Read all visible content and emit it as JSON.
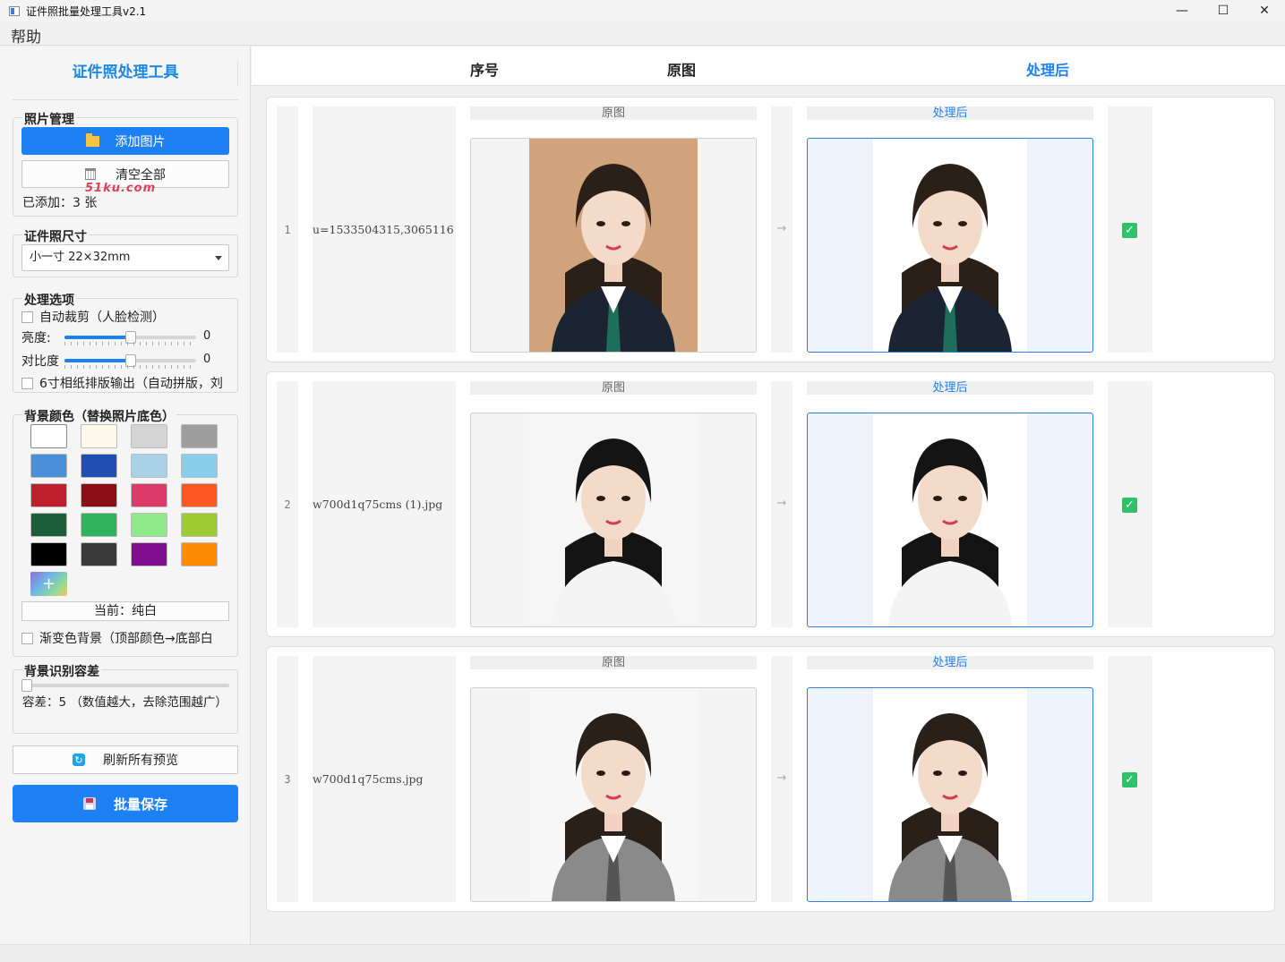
{
  "window": {
    "title": "证件照批量处理工具v2.1",
    "minimize": "—",
    "maximize": "☐",
    "close": "✕"
  },
  "menu": {
    "help": "帮助"
  },
  "sidebar": {
    "title": "证件照处理工具",
    "photo_mgmt": {
      "label": "照片管理",
      "add_button": "添加图片",
      "clear_button": "清空全部",
      "count_text": "已添加：3 张",
      "watermark": "51ku.com"
    },
    "size": {
      "label": "证件照尺寸",
      "selected": "小一寸  22×32mm"
    },
    "options": {
      "label": "处理选项",
      "auto_crop": "自动裁剪（人脸检测）",
      "brightness_label": "亮度:",
      "brightness_value": "0",
      "brightness_level": 0.5,
      "contrast_label": "对比度",
      "contrast_value": "0",
      "contrast_level": 0.5,
      "layout_6inch": "6寸相纸排版输出（自动拼版，刘"
    },
    "background": {
      "label": "背景颜色（替换照片底色）",
      "swatches": [
        "#ffffff",
        "#fdf8ea",
        "#d4d4d4",
        "#9e9e9e",
        "#4a90d9",
        "#1f4fb3",
        "#a9d1e6",
        "#87ceeb",
        "#c0202e",
        "#8b0f17",
        "#dd3b69",
        "#ff5722",
        "#1d5e3a",
        "#2fb35d",
        "#8fea8a",
        "#9ccc31",
        "#000000",
        "#3a3a3a",
        "#7f0f8f",
        "#ff8c00"
      ],
      "add_symbol": "+",
      "current_text": "当前：纯白",
      "gradient_option": "渐变色背景（顶部颜色→底部白"
    },
    "tolerance": {
      "label": "背景识别容差",
      "level": 0.0,
      "text": "容差：5  （数值越大，去除范围越广）"
    },
    "refresh_button": "刷新所有预览",
    "save_button": "批量保存"
  },
  "table": {
    "headers": {
      "index": "序号",
      "original": "原图",
      "processed": "处理后"
    },
    "rows": [
      {
        "index": "1",
        "filename": "u=1533504315,3065116",
        "original_label": "原图",
        "processed_label": "处理后",
        "arrow": "→",
        "checked": true
      },
      {
        "index": "2",
        "filename": "w700d1q75cms (1).jpg",
        "original_label": "原图",
        "processed_label": "处理后",
        "arrow": "→",
        "checked": true
      },
      {
        "index": "3",
        "filename": "w700d1q75cms.jpg",
        "original_label": "原图",
        "processed_label": "处理后",
        "arrow": "→",
        "checked": true
      }
    ]
  },
  "colors": {
    "accent": "#1e80f5",
    "check": "#2ec26a"
  }
}
